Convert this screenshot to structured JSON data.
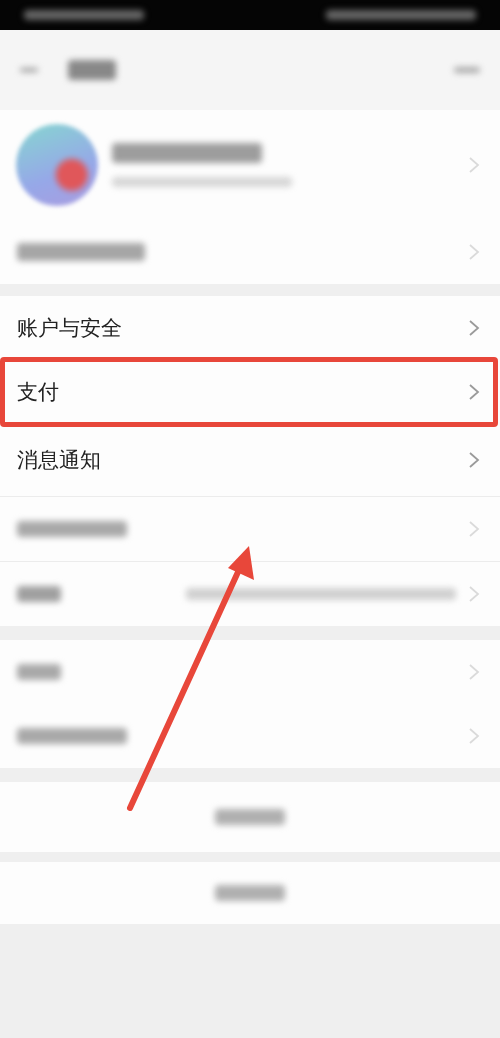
{
  "sections": [
    {
      "kind": "profile"
    },
    {
      "kind": "list",
      "rows": [
        {
          "kind": "text",
          "label": "账户与安全",
          "highlighted": false
        },
        {
          "kind": "text",
          "label": "支付",
          "highlighted": true
        },
        {
          "kind": "text",
          "label": "消息通知",
          "highlighted": false
        },
        {
          "kind": "blurred"
        },
        {
          "kind": "blurred-value"
        }
      ]
    },
    {
      "kind": "list",
      "rows": [
        {
          "kind": "blurred"
        },
        {
          "kind": "blurred"
        }
      ]
    },
    {
      "kind": "action"
    },
    {
      "kind": "action"
    }
  ],
  "annotation_arrow": true
}
